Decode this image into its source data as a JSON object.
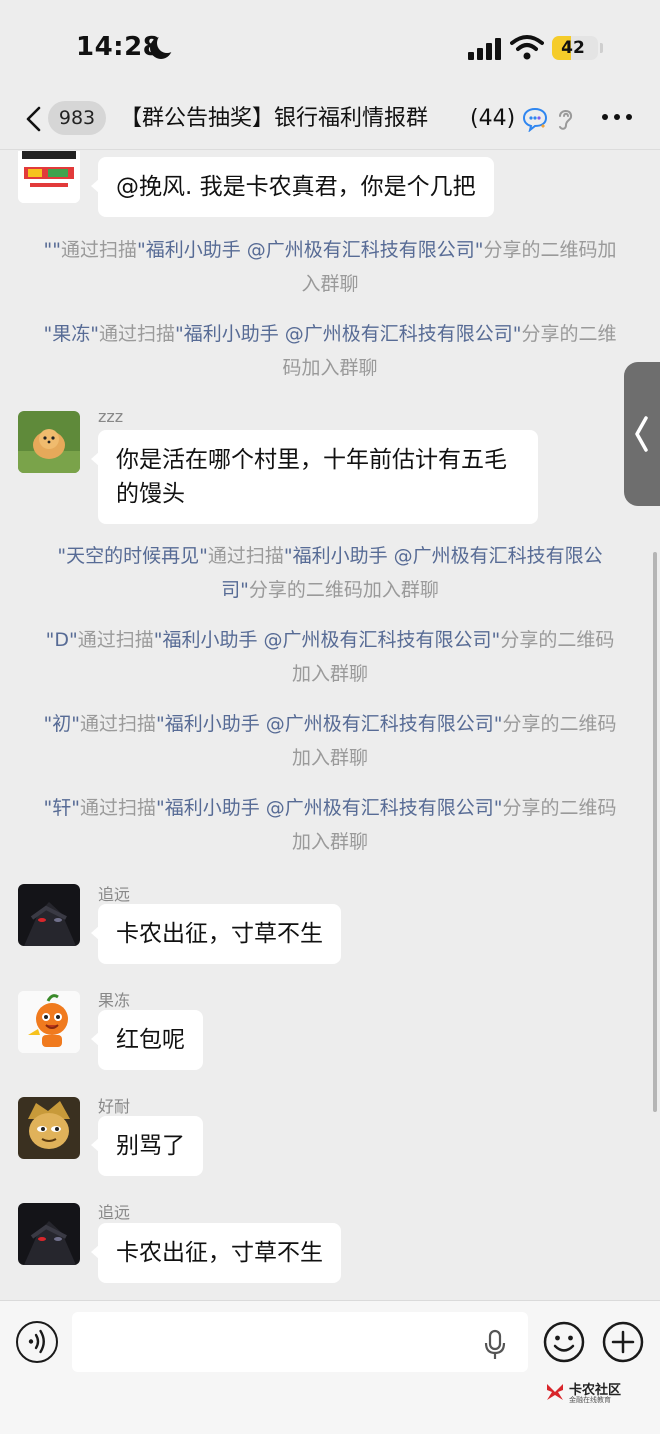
{
  "status_bar": {
    "time": "14:28",
    "battery_level": "42",
    "battery_fraction": 0.42
  },
  "header": {
    "unread_count": "983",
    "title": "【群公告抽奖】银行福利情报群",
    "member_count": "(44)"
  },
  "messages": [
    {
      "type": "chat",
      "sender": "",
      "text": "@挽风. 我是卡农真君，你是个几把",
      "avatar": "shop-logo-avatar"
    },
    {
      "type": "system",
      "name": "\"\"",
      "via": "通过扫描",
      "inviter": "\"福利小助手 @广州极有汇科技有限公司\"",
      "suffix": "分享的二维码加入群聊"
    },
    {
      "type": "system",
      "name": "\"果冻\"",
      "via": "通过扫描",
      "inviter": "\"福利小助手 @广州极有汇科技有限公司\"",
      "suffix": "分享的二维码加入群聊"
    },
    {
      "type": "chat",
      "sender": "zzz",
      "text": "你是活在哪个村里，十年前估计有五毛的馒头",
      "avatar": "dog-photo-avatar"
    },
    {
      "type": "system",
      "name": "\"天空的时候再见\"",
      "via": "通过扫描",
      "inviter": "\"福利小助手 @广州极有汇科技有限公司\"",
      "suffix": "分享的二维码加入群聊"
    },
    {
      "type": "system",
      "name": "\"D\"",
      "via": "通过扫描",
      "inviter": "\"福利小助手 @广州极有汇科技有限公司\"",
      "suffix": "分享的二维码加入群聊"
    },
    {
      "type": "system",
      "name": "\"初\"",
      "via": "通过扫描",
      "inviter": "\"福利小助手 @广州极有汇科技有限公司\"",
      "suffix": "分享的二维码加入群聊"
    },
    {
      "type": "system",
      "name": "\"轩\"",
      "via": "通过扫描",
      "inviter": "\"福利小助手 @广州极有汇科技有限公司\"",
      "suffix": "分享的二维码加入群聊"
    },
    {
      "type": "chat",
      "sender": "追远",
      "text": "卡农出征，寸草不生",
      "avatar": "dark-anime-avatar"
    },
    {
      "type": "chat",
      "sender": "果冻",
      "text": "红包呢",
      "avatar": "cartoon-mascot-avatar"
    },
    {
      "type": "chat",
      "sender": "好耐",
      "text": "别骂了",
      "avatar": "cartoon-face-avatar"
    },
    {
      "type": "chat",
      "sender": "追远",
      "text": "卡农出征，寸草不生",
      "avatar": "dark-anime-avatar"
    }
  ],
  "input_bar": {
    "message_value": "",
    "placeholder": ""
  },
  "watermark": {
    "title": "卡农社区",
    "subtitle": "金融在线教育"
  },
  "colors": {
    "background": "#ededed",
    "bubble": "#ffffff",
    "system_name": "#576b95",
    "system_text": "#9a9a9a",
    "battery": "#f5cc2a"
  }
}
